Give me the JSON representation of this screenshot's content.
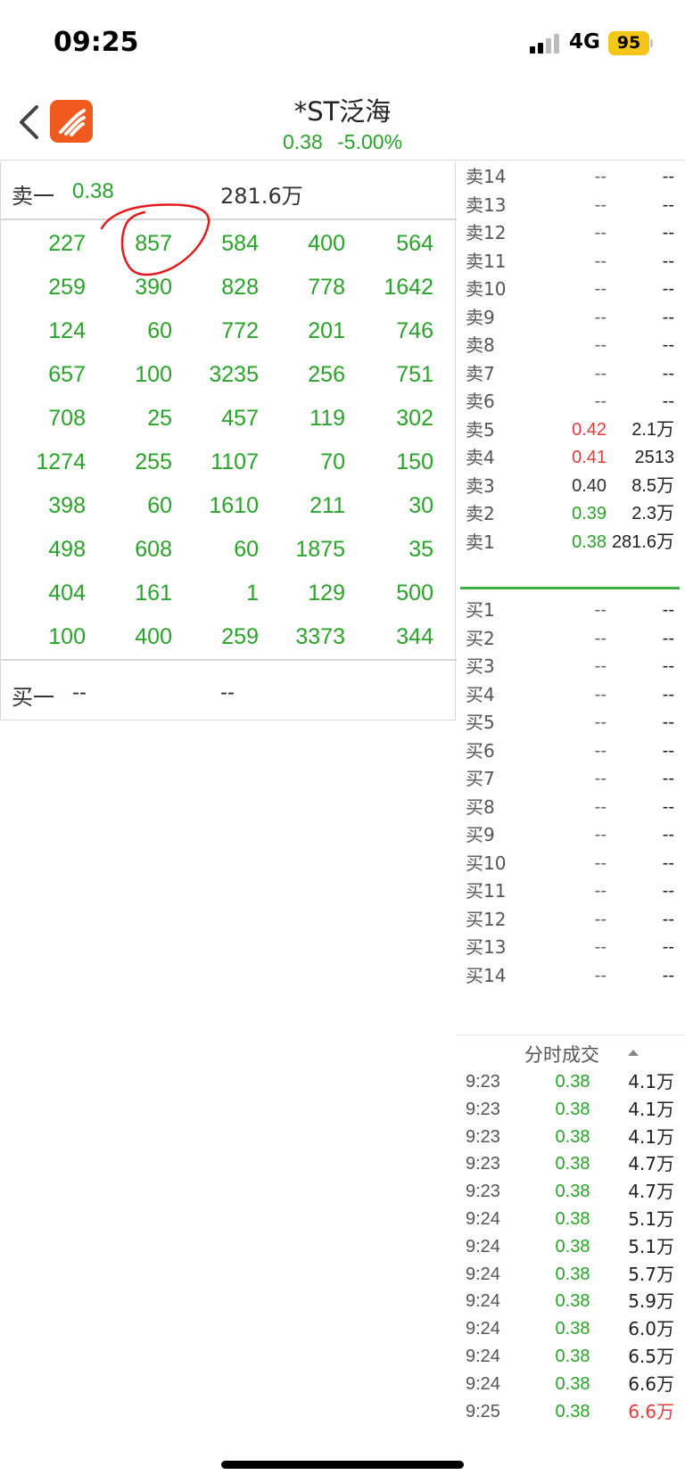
{
  "status_bar": {
    "time": "09:25",
    "network": "4G",
    "battery": "95"
  },
  "header": {
    "stock_name": "*ST泛海",
    "price": "0.38",
    "change_pct": "-5.00%",
    "quote_color": "#2aa32a",
    "logo_color": "#f05a1f"
  },
  "tick_panel": {
    "ask_label": "卖一",
    "ask_price": "0.38",
    "ask_volume": "281.6万",
    "rows": [
      [
        "227",
        "857",
        "584",
        "400",
        "564"
      ],
      [
        "259",
        "390",
        "828",
        "778",
        "1642"
      ],
      [
        "124",
        "60",
        "772",
        "201",
        "746"
      ],
      [
        "657",
        "100",
        "3235",
        "256",
        "751"
      ],
      [
        "708",
        "25",
        "457",
        "119",
        "302"
      ],
      [
        "1274",
        "255",
        "1107",
        "70",
        "150"
      ],
      [
        "398",
        "60",
        "1610",
        "211",
        "30"
      ],
      [
        "498",
        "608",
        "60",
        "1875",
        "35"
      ],
      [
        "404",
        "161",
        "1",
        "129",
        "500"
      ],
      [
        "100",
        "400",
        "259",
        "3373",
        "344"
      ]
    ],
    "bid_label": "买一",
    "bid_price": "--",
    "bid_volume": "--"
  },
  "order_book": {
    "asks": [
      {
        "level": "卖14",
        "price": "--",
        "volume": "--",
        "color": "#666666"
      },
      {
        "level": "卖13",
        "price": "--",
        "volume": "--",
        "color": "#666666"
      },
      {
        "level": "卖12",
        "price": "--",
        "volume": "--",
        "color": "#666666"
      },
      {
        "level": "卖11",
        "price": "--",
        "volume": "--",
        "color": "#666666"
      },
      {
        "level": "卖10",
        "price": "--",
        "volume": "--",
        "color": "#666666"
      },
      {
        "level": "卖9",
        "price": "--",
        "volume": "--",
        "color": "#666666"
      },
      {
        "level": "卖8",
        "price": "--",
        "volume": "--",
        "color": "#666666"
      },
      {
        "level": "卖7",
        "price": "--",
        "volume": "--",
        "color": "#666666"
      },
      {
        "level": "卖6",
        "price": "--",
        "volume": "--",
        "color": "#666666"
      },
      {
        "level": "卖5",
        "price": "0.42",
        "volume": "2.1万",
        "color": "#e23c3c"
      },
      {
        "level": "卖4",
        "price": "0.41",
        "volume": "2513",
        "color": "#e23c3c"
      },
      {
        "level": "卖3",
        "price": "0.40",
        "volume": "8.5万",
        "color": "#333333"
      },
      {
        "level": "卖2",
        "price": "0.39",
        "volume": "2.3万",
        "color": "#2aa32a"
      },
      {
        "level": "卖1",
        "price": "0.38",
        "volume": "281.6万",
        "color": "#2aa32a"
      }
    ],
    "bids": [
      {
        "level": "买1",
        "price": "--",
        "volume": "--"
      },
      {
        "level": "买2",
        "price": "--",
        "volume": "--"
      },
      {
        "level": "买3",
        "price": "--",
        "volume": "--"
      },
      {
        "level": "买4",
        "price": "--",
        "volume": "--"
      },
      {
        "level": "买5",
        "price": "--",
        "volume": "--"
      },
      {
        "level": "买6",
        "price": "--",
        "volume": "--"
      },
      {
        "level": "买7",
        "price": "--",
        "volume": "--"
      },
      {
        "level": "买8",
        "price": "--",
        "volume": "--"
      },
      {
        "level": "买9",
        "price": "--",
        "volume": "--"
      },
      {
        "level": "买10",
        "price": "--",
        "volume": "--"
      },
      {
        "level": "买11",
        "price": "--",
        "volume": "--"
      },
      {
        "level": "买12",
        "price": "--",
        "volume": "--"
      },
      {
        "level": "买13",
        "price": "--",
        "volume": "--"
      },
      {
        "level": "买14",
        "price": "--",
        "volume": "--"
      }
    ]
  },
  "trades": {
    "title": "分时成交",
    "rows": [
      {
        "time": "9:23",
        "price": "0.38",
        "volume": "4.1万",
        "vcolor": "#222222"
      },
      {
        "time": "9:23",
        "price": "0.38",
        "volume": "4.1万",
        "vcolor": "#222222"
      },
      {
        "time": "9:23",
        "price": "0.38",
        "volume": "4.1万",
        "vcolor": "#222222"
      },
      {
        "time": "9:23",
        "price": "0.38",
        "volume": "4.7万",
        "vcolor": "#222222"
      },
      {
        "time": "9:23",
        "price": "0.38",
        "volume": "4.7万",
        "vcolor": "#222222"
      },
      {
        "time": "9:24",
        "price": "0.38",
        "volume": "5.1万",
        "vcolor": "#222222"
      },
      {
        "time": "9:24",
        "price": "0.38",
        "volume": "5.1万",
        "vcolor": "#222222"
      },
      {
        "time": "9:24",
        "price": "0.38",
        "volume": "5.7万",
        "vcolor": "#222222"
      },
      {
        "time": "9:24",
        "price": "0.38",
        "volume": "5.9万",
        "vcolor": "#222222"
      },
      {
        "time": "9:24",
        "price": "0.38",
        "volume": "6.0万",
        "vcolor": "#222222"
      },
      {
        "time": "9:24",
        "price": "0.38",
        "volume": "6.5万",
        "vcolor": "#222222"
      },
      {
        "time": "9:24",
        "price": "0.38",
        "volume": "6.6万",
        "vcolor": "#222222"
      },
      {
        "time": "9:25",
        "price": "0.38",
        "volume": "6.6万",
        "vcolor": "#e23c3c"
      }
    ]
  }
}
